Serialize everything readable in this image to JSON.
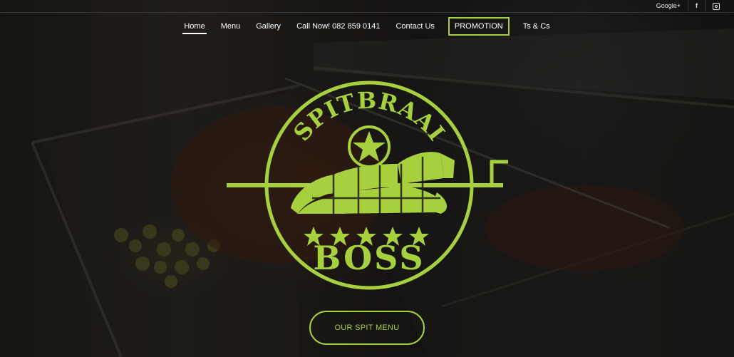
{
  "topbar": {
    "google": "Google+",
    "facebook": "f",
    "instagram_icon": "instagram-icon"
  },
  "nav": {
    "items": [
      "Home",
      "Menu",
      "Gallery",
      "Call Now! 082 859 0141",
      "Contact Us",
      "PROMOTION",
      "Ts & Cs"
    ],
    "active": "Home"
  },
  "logo": {
    "top_text": "SPITBRAAI",
    "bottom_text": "BOSS",
    "star_count": 5,
    "color": "#a7d03e"
  },
  "hero": {
    "cta_label": "OUR SPIT MENU"
  },
  "colors": {
    "accent": "#a7d03e",
    "nav_text": "#ffffff"
  }
}
